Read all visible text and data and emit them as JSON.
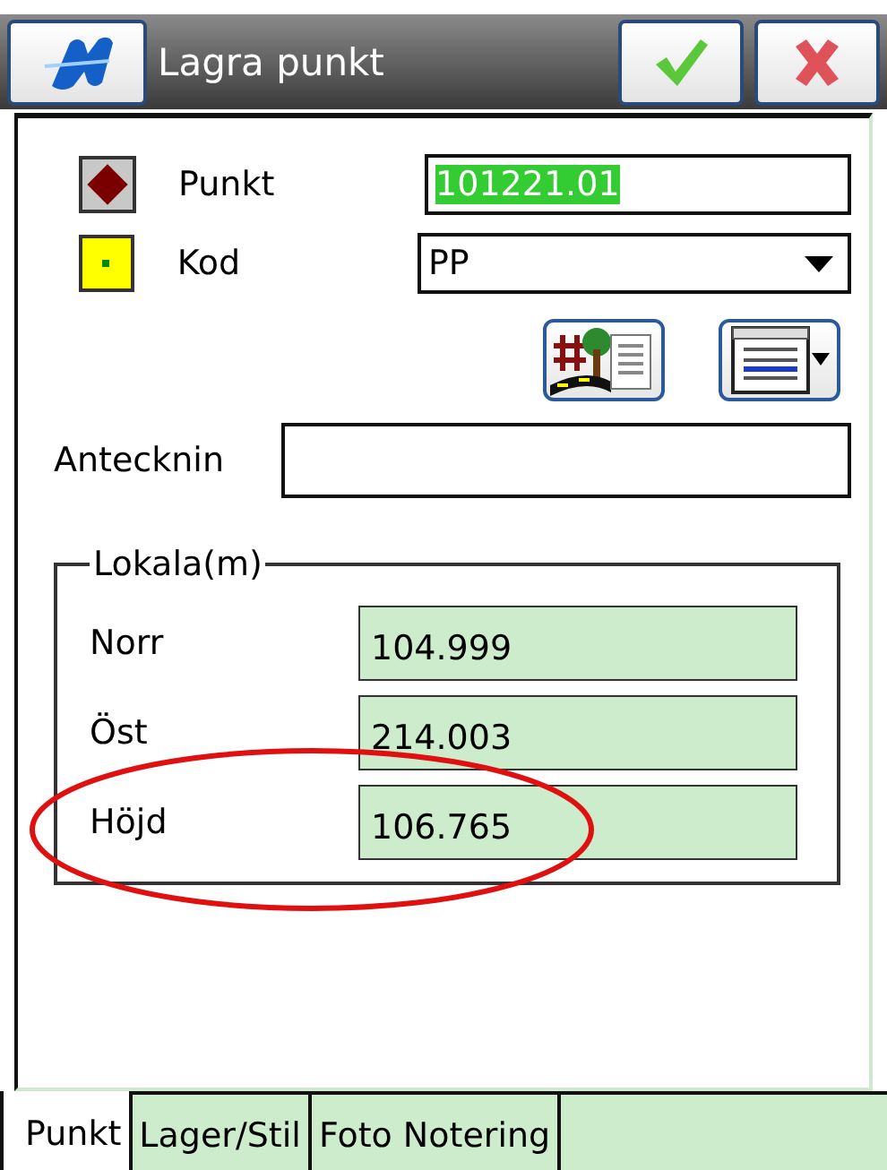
{
  "title_bar": {
    "title": "Lagra punkt"
  },
  "fields": [
    {
      "kind": "point",
      "label": "Punkt",
      "value": "101221.01",
      "text_selected": true
    },
    {
      "kind": "code",
      "label": "Kod",
      "value": "PP"
    }
  ],
  "note": {
    "label": "Antecknin"
  },
  "local_group": {
    "title": "Lokala(m)",
    "rows": [
      {
        "label": "Norr",
        "value": "104.999"
      },
      {
        "label": "Öst",
        "value": "214.003"
      },
      {
        "label": "Höjd",
        "value": "106.765"
      }
    ]
  },
  "tabs": [
    {
      "label": "Punkt",
      "selected": true
    },
    {
      "label": "Lager/Stil",
      "selected": false
    },
    {
      "label": "Foto Notering",
      "selected": false
    }
  ]
}
